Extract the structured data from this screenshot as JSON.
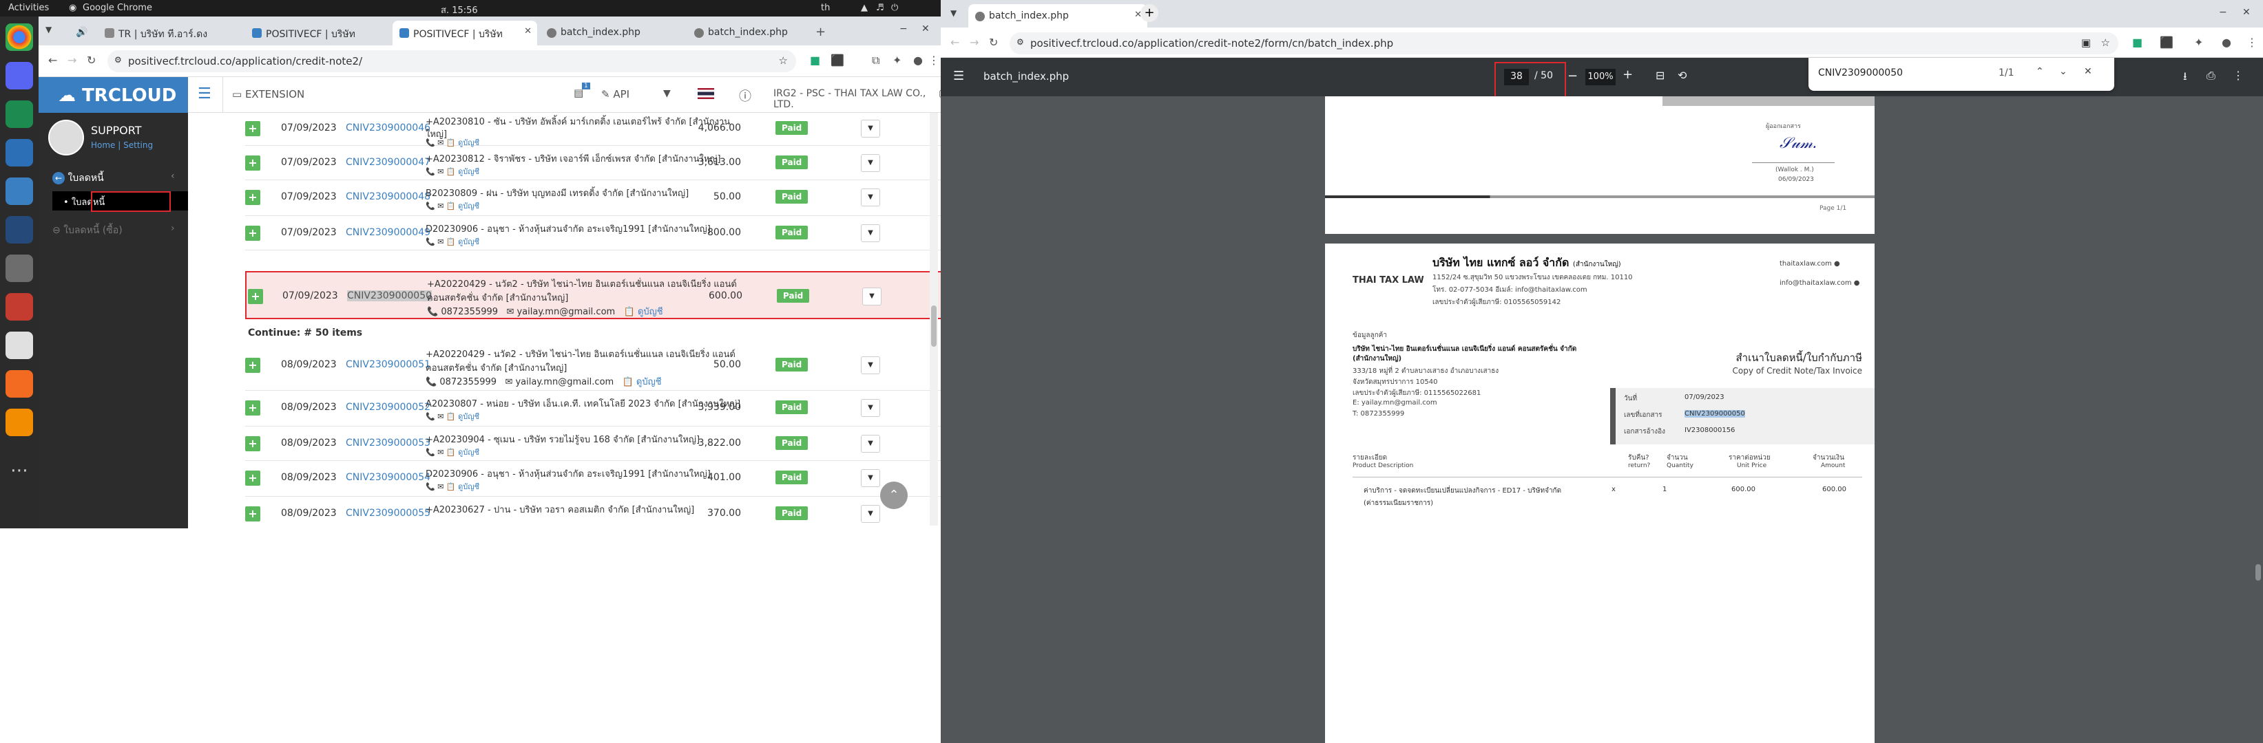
{
  "system": {
    "activities": "Activities",
    "app_name": "Google Chrome",
    "clock": "ส. 15:56",
    "lang": "th"
  },
  "left_window": {
    "tabs": [
      {
        "label": "TR | บริษัท ที.อาร์.ดง"
      },
      {
        "label": "POSITIVECF | บริษัท"
      },
      {
        "label": "POSITIVECF | บริษัท"
      },
      {
        "label": "batch_index.php"
      },
      {
        "label": "batch_index.php"
      }
    ],
    "url": "positivecf.trcloud.co/application/credit-note2/",
    "app": {
      "logo": "TRCLOUD",
      "header_items": [
        "EXTENSION",
        "API"
      ],
      "api_badge": "1",
      "company": "IRG2 - PSC - THAI TAX LAW CO., LTD.",
      "user": {
        "name": "SUPPORT",
        "home": "Home",
        "setting": "Setting"
      },
      "sidebar": {
        "section": "ใบลดหนี้",
        "active_item": "ใบลดหนี้",
        "other_item": "ใบลดหนี้ (ซื้อ)"
      },
      "rows_top": [
        {
          "date": "07/09/2023",
          "doc": "CNIV2309000046",
          "desc1": "+A20230810 - ซัน - บริษัท อัพลิ้งค์ มาร์เกตติ้ง เอนเตอร์ไพร้ จำกัด [สำนักงาน",
          "desc2": "ใหญ่]",
          "amount": "4,066.00",
          "status": "Paid"
        },
        {
          "date": "07/09/2023",
          "doc": "CNIV2309000047",
          "desc1": "+A20230812 - จิราพัชร - บริษัท เจอาร์พี เอ็กซ์เพรส จำกัด [สำนักงานใหญ่]",
          "amount": "3,613.00",
          "status": "Paid"
        },
        {
          "date": "07/09/2023",
          "doc": "CNIV2309000048",
          "desc1": "B20230809 - ฝน - บริษัท บุญทองมี เทรดดิ้ง จำกัด [สำนักงานใหญ่]",
          "amount": "50.00",
          "status": "Paid"
        },
        {
          "date": "07/09/2023",
          "doc": "CNIV2309000049",
          "desc1": "D20230906 - อนุชา - ห้างหุ้นส่วนจำกัด อระเจริญ1991 [สำนักงานใหญ่]",
          "amount": "800.00",
          "status": "Paid"
        }
      ],
      "highlight_row": {
        "date": "07/09/2023",
        "doc": "CNIV2309000050",
        "desc1": "+A20220429 - นวัต2 - บริษัท ไชน่า-ไทย อินเตอร์เนชั่นแนล เอนจิเนียริ่ง แอนด์",
        "desc2": "คอนสตรัคชั่น จำกัด [สำนักงานใหญ่]",
        "phone": "0872355999",
        "email": "yailay.mn@gmail.com",
        "account": "ดูบัญชี",
        "amount": "600.00",
        "status": "Paid"
      },
      "continue_label": "Continue: # 50 items",
      "rows_bottom": [
        {
          "date": "08/09/2023",
          "doc": "CNIV2309000051",
          "desc1": "+A20220429 - นวัต2 - บริษัท ไชน่า-ไทย อินเตอร์เนชั่นแนล เอนจิเนียริ่ง แอนด์",
          "desc2": "คอนสตรัคชั่น จำกัด [สำนักงานใหญ่]",
          "phone": "0872355999",
          "email": "yailay.mn@gmail.com",
          "amount": "50.00",
          "status": "Paid"
        },
        {
          "date": "08/09/2023",
          "doc": "CNIV2309000052",
          "desc1": "A20230807 - หน่อย - บริษัท เอ็น.เค.ที. เทคโนโลยี 2023 จำกัด [สำนักงานใหญ่]",
          "amount": "3,939.00",
          "status": "Paid"
        },
        {
          "date": "08/09/2023",
          "doc": "CNIV2309000053",
          "desc1": "+A20230904 - ซุเมน - บริษัท รวยไม่รู้จบ 168 จำกัด [สำนักงานใหญ่]",
          "amount": "3,822.00",
          "status": "Paid"
        },
        {
          "date": "08/09/2023",
          "doc": "CNIV2309000054",
          "desc1": "D20230906 - อนุชา - ห้างหุ้นส่วนจำกัด อระเจริญ1991 [สำนักงานใหญ่]",
          "amount": "401.00",
          "status": "Paid"
        },
        {
          "date": "08/09/2023",
          "doc": "CNIV2309000055",
          "desc1": "+A20230627 - ปาน - บริษัท วอรา คอสเมติก จำกัด [สำนักงานใหญ่]",
          "amount": "370.00",
          "status": "Paid"
        }
      ]
    }
  },
  "right_window": {
    "tab": "batch_index.php",
    "url": "positivecf.trcloud.co/application/credit-note2/form/cn/batch_index.php",
    "pdf": {
      "title": "batch_index.php",
      "page_current": "38",
      "page_total": "50",
      "zoom": "100%",
      "find_query": "CNIV2309000050",
      "find_count": "1/1",
      "prev_page": {
        "signer": "(Wallok . M.)",
        "date": "06/09/2023",
        "page_label": "Page 1/1",
        "sign_caption": "ผู้ออกเอกสาร"
      },
      "doc": {
        "logo": "THAI TAX LAW",
        "company": "บริษัท ไทย แทกซ์ ลอว์ จำกัด",
        "company_suffix": "(สำนักงานใหญ่)",
        "addr1": "1152/24 ซ.สุขุมวิท 50 แขวงพระโขนง เขตคลองเตย กทม. 10110",
        "addr2": "โทร. 02-077-5034   อีเมล์: info@thaitaxlaw.com",
        "taxid": "เลขประจำตัวผู้เสียภาษี: 0105565059142",
        "web": "thaitaxlaw.com",
        "mail": "info@thaitaxlaw.com",
        "cust_label": "ข้อมูลลูกค้า",
        "cust1": "บริษัท ไชน่า-ไทย อินเตอร์เนชั่นแนล เอนจิเนียริ่ง แอนด์ คอนสตรัคชั่น จำกัด",
        "cust2": "(สำนักงานใหญ่)",
        "cust3": "333/18 หมู่ที่ 2 ตำบลบางเสาธง อำเภอบางเสาธง",
        "cust4": "จังหวัดสมุทรปราการ 10540",
        "cust5": "เลขประจำตัวผู้เสียภาษี: 0115565022681",
        "cust6": "E: yailay.mn@gmail.com",
        "cust7": "T: 0872355999",
        "doc_title_th": "สำเนาใบลดหนี้/ใบกำกับภาษี",
        "doc_title_en": "Copy of Credit Note/Tax Invoice",
        "meta": [
          {
            "k": "วันที่",
            "v": "07/09/2023"
          },
          {
            "k": "เลขที่เอกสาร",
            "v": "CNIV2309000050"
          },
          {
            "k": "เอกสารอ้างอิง",
            "v": "IV2308000156"
          }
        ],
        "cols": [
          {
            "th": "รายละเอียด",
            "en": "Product Description"
          },
          {
            "th": "รับคืน?",
            "en": "return?"
          },
          {
            "th": "จำนวน",
            "en": "Quantity"
          },
          {
            "th": "ราคาต่อหน่วย",
            "en": "Unit Price"
          },
          {
            "th": "จำนวนเงิน",
            "en": "Amount"
          }
        ],
        "item": {
          "desc1": "ค่าบริการ - จดจดทะเบียนเปลี่ยนแปลงกิจการ - ED17 - บริษัทจำกัด",
          "desc2": "(ค่าธรรมเนียมราชการ)",
          "ret": "x",
          "qty": "1",
          "unit": "600.00",
          "amount": "600.00"
        }
      }
    }
  }
}
